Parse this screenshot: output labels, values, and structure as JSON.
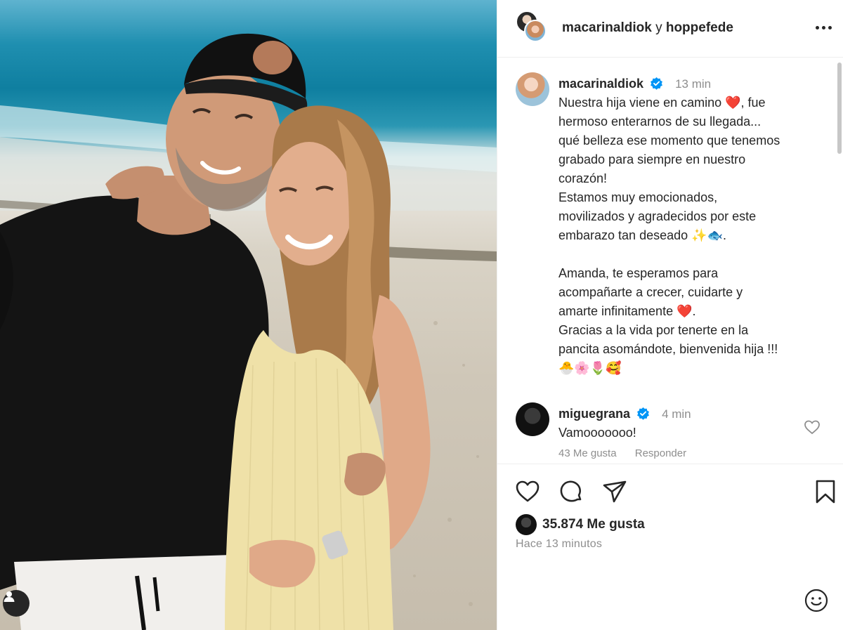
{
  "post": {
    "header_user1": "macarinaldiok",
    "header_connector": "y",
    "header_user2": "hoppefede"
  },
  "caption": {
    "username": "macarinaldiok",
    "time": "13 min",
    "lines": [
      "Nuestra hija viene en camino ❤️, fue",
      "hermoso enterarnos de su llegada...",
      "qué belleza ese momento que tenemos",
      "grabado para siempre en nuestro",
      "corazón!",
      "Estamos muy emocionados,",
      "movilizados y agradecidos por este",
      "embarazo tan deseado ✨🐟.",
      "",
      "Amanda, te esperamos para",
      "acompañarte a crecer, cuidarte y",
      "amarte infinitamente ❤️.",
      "Gracias a la vida por tenerte en la",
      "pancita asomándote, bienvenida hija !!!",
      "🐣🌸🌷🥰"
    ]
  },
  "comment": {
    "username": "miguegrana",
    "time": "4 min",
    "text": "Vamooooooo!",
    "likes": "43 Me gusta",
    "reply": "Responder"
  },
  "stats": {
    "likes": "35.874 Me gusta",
    "time_ago": "Hace 13 minutos"
  },
  "colors": {
    "verified": "#0095f6",
    "text": "#262626",
    "muted": "#8e8e8e"
  },
  "icons": [
    "user-tag-icon",
    "more-options-icon",
    "verified-icon",
    "like-heart-icon",
    "comment-icon",
    "share-icon",
    "save-bookmark-icon",
    "emoji-icon"
  ]
}
